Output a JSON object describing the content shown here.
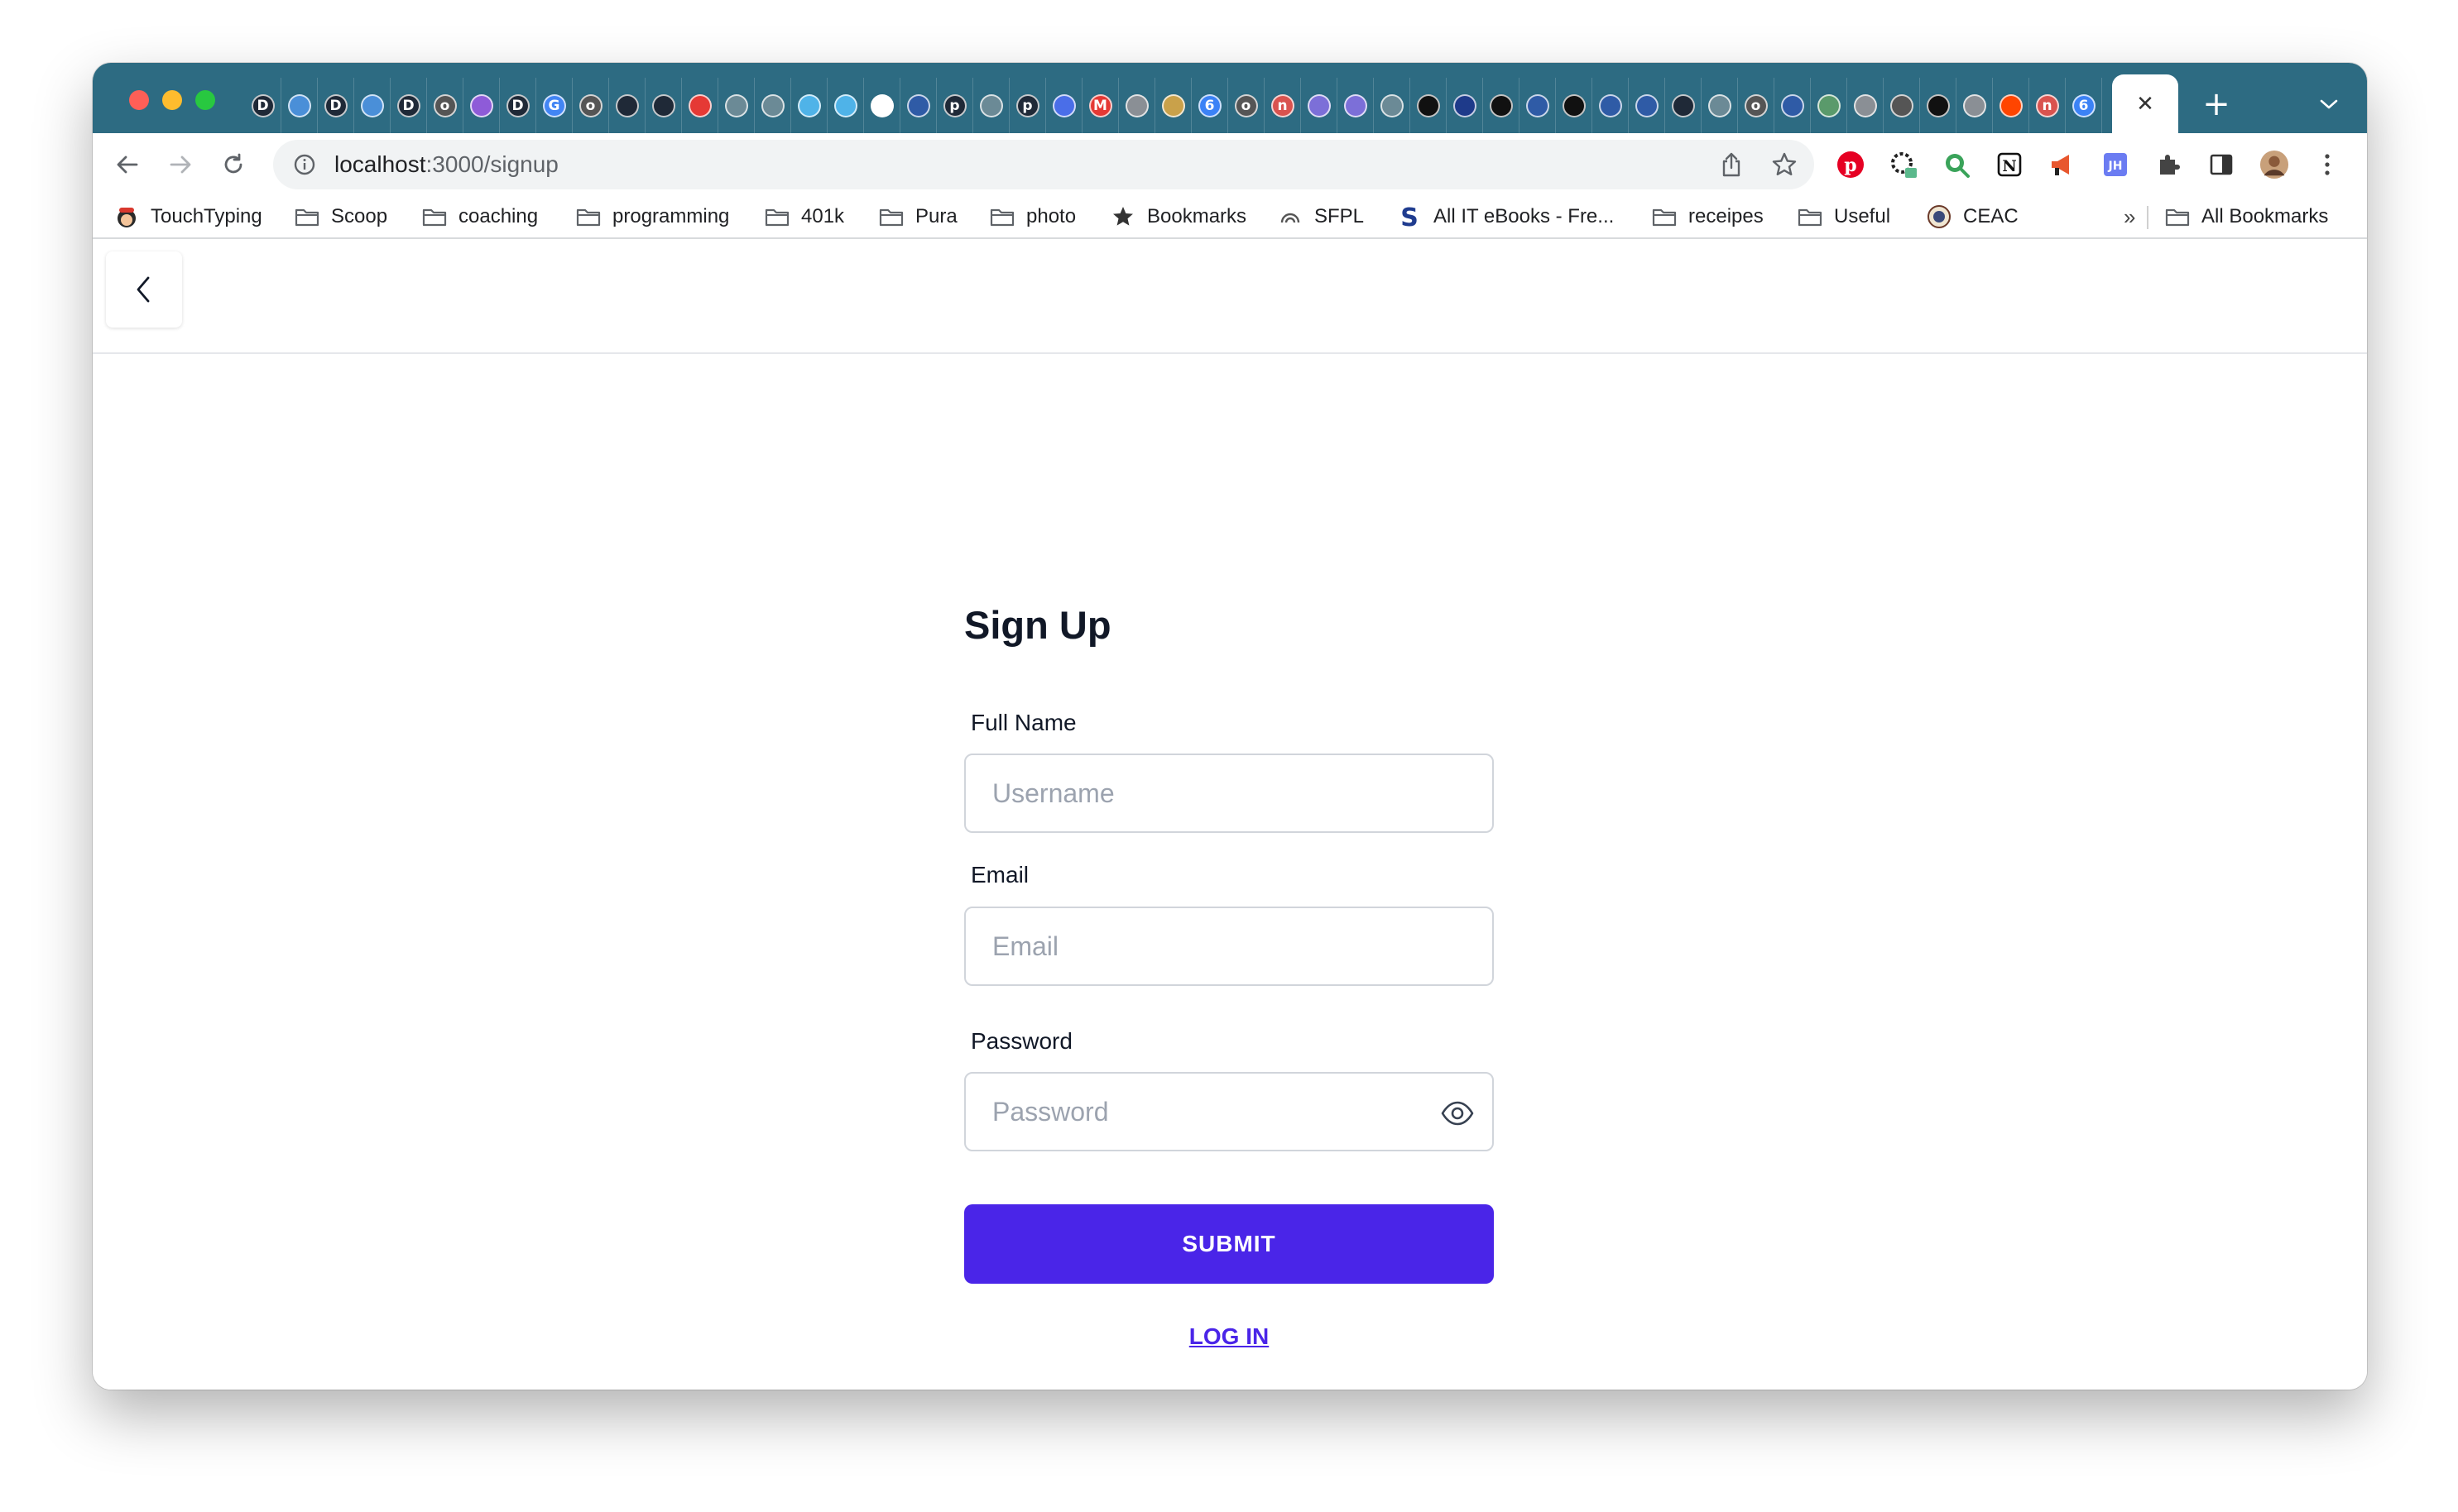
{
  "browser": {
    "url_host": "localhost",
    "url_path": ":3000/signup",
    "pinned_tab_icons": [
      {
        "name": "dev-icon",
        "glyph": "D",
        "color": "#1f2937"
      },
      {
        "name": "circle-icon",
        "glyph": "",
        "color": "#4a8fd8"
      },
      {
        "name": "dev-icon",
        "glyph": "D",
        "color": "#1f2937"
      },
      {
        "name": "circle-icon",
        "glyph": "",
        "color": "#4a8fd8"
      },
      {
        "name": "dev-icon",
        "glyph": "D",
        "color": "#1f2937"
      },
      {
        "name": "outline-icon",
        "glyph": "o",
        "color": "#555555"
      },
      {
        "name": "shield-icon",
        "glyph": "",
        "color": "#8e5bd8"
      },
      {
        "name": "dev-icon",
        "glyph": "D",
        "color": "#1f2937"
      },
      {
        "name": "google-icon",
        "glyph": "G",
        "color": "#4285f4"
      },
      {
        "name": "outline-icon",
        "glyph": "o",
        "color": "#555555"
      },
      {
        "name": "shield-icon",
        "glyph": "",
        "color": "#1f2937"
      },
      {
        "name": "shield-icon",
        "glyph": "",
        "color": "#1f2937"
      },
      {
        "name": "youtube-icon",
        "glyph": "",
        "color": "#e53935"
      },
      {
        "name": "circle-icon",
        "glyph": "",
        "color": "#6b8a96"
      },
      {
        "name": "circle-icon",
        "glyph": "",
        "color": "#6b8a96"
      },
      {
        "name": "react-icon",
        "glyph": "",
        "color": "#4fb3e8"
      },
      {
        "name": "circle-icon",
        "glyph": "",
        "color": "#4fb3e8"
      },
      {
        "name": "sail-icon",
        "glyph": "",
        "color": "#ffffff"
      },
      {
        "name": "circle-icon",
        "glyph": "",
        "color": "#2f5ba6"
      },
      {
        "name": "p-icon",
        "glyph": "p",
        "color": "#1f2937"
      },
      {
        "name": "circle-icon",
        "glyph": "",
        "color": "#6b8a96"
      },
      {
        "name": "p-icon",
        "glyph": "p",
        "color": "#1f2937"
      },
      {
        "name": "circle-icon",
        "glyph": "",
        "color": "#4a6ee8"
      },
      {
        "name": "gmail-icon",
        "glyph": "M",
        "color": "#e53935"
      },
      {
        "name": "circle-icon",
        "glyph": "",
        "color": "#8a8f95"
      },
      {
        "name": "circle-icon",
        "glyph": "",
        "color": "#c9a14a"
      },
      {
        "name": "calendar-icon",
        "glyph": "6",
        "color": "#3b82f6"
      },
      {
        "name": "outline-icon",
        "glyph": "o",
        "color": "#555555"
      },
      {
        "name": "n-icon",
        "glyph": "n",
        "color": "#d9534f"
      },
      {
        "name": "circle-icon",
        "glyph": "",
        "color": "#7c6fd8"
      },
      {
        "name": "circle-icon",
        "glyph": "",
        "color": "#7c6fd8"
      },
      {
        "name": "circle-icon",
        "glyph": "",
        "color": "#6b8a96"
      },
      {
        "name": "gear-icon",
        "glyph": "",
        "color": "#111111"
      },
      {
        "name": "circle-icon",
        "glyph": "",
        "color": "#1e3a8a"
      },
      {
        "name": "gear-icon",
        "glyph": "",
        "color": "#111111"
      },
      {
        "name": "circle-icon",
        "glyph": "",
        "color": "#2f5ba6"
      },
      {
        "name": "gear-icon",
        "glyph": "",
        "color": "#111111"
      },
      {
        "name": "circle-icon",
        "glyph": "",
        "color": "#2f5ba6"
      },
      {
        "name": "circle-icon",
        "glyph": "",
        "color": "#2f5ba6"
      },
      {
        "name": "check-icon",
        "glyph": "",
        "color": "#1f2937"
      },
      {
        "name": "circle-icon",
        "glyph": "",
        "color": "#6b8a96"
      },
      {
        "name": "outline-icon",
        "glyph": "o",
        "color": "#555555"
      },
      {
        "name": "circle-icon",
        "glyph": "",
        "color": "#2f5ba6"
      },
      {
        "name": "circle-icon",
        "glyph": "",
        "color": "#5a9a6b"
      },
      {
        "name": "circle-icon",
        "glyph": "",
        "color": "#8a8f95"
      },
      {
        "name": "github-icon",
        "glyph": "",
        "color": "#555555"
      },
      {
        "name": "github-icon",
        "glyph": "",
        "color": "#111111"
      },
      {
        "name": "circle-icon",
        "glyph": "",
        "color": "#8a8f95"
      },
      {
        "name": "reddit-icon",
        "glyph": "",
        "color": "#ff4500"
      },
      {
        "name": "n-icon",
        "glyph": "n",
        "color": "#d9534f"
      },
      {
        "name": "calendar-icon",
        "glyph": "6",
        "color": "#3b82f6"
      }
    ],
    "active_tab_close": "✕",
    "new_tab": "+"
  },
  "bookmarks": [
    {
      "label": "TouchTyping",
      "icon": "touchtyping-icon"
    },
    {
      "label": "Scoop",
      "icon": "folder-icon"
    },
    {
      "label": "coaching",
      "icon": "folder-icon"
    },
    {
      "label": "programming",
      "icon": "folder-icon"
    },
    {
      "label": "401k",
      "icon": "folder-icon"
    },
    {
      "label": "Pura",
      "icon": "folder-icon"
    },
    {
      "label": "photo",
      "icon": "folder-icon"
    },
    {
      "label": "Bookmarks",
      "icon": "star-icon"
    },
    {
      "label": "SFPL",
      "icon": "sfpl-icon"
    },
    {
      "label": "All IT eBooks - Fre...",
      "icon": "s-logo-icon"
    },
    {
      "label": "receipes",
      "icon": "folder-icon"
    },
    {
      "label": "Useful",
      "icon": "folder-icon"
    },
    {
      "label": "CEAC",
      "icon": "seal-icon"
    }
  ],
  "bookmarks_overflow": "»",
  "all_bookmarks": "All Bookmarks",
  "form": {
    "title": "Sign Up",
    "full_name_label": "Full Name",
    "full_name_placeholder": "Username",
    "email_label": "Email",
    "email_placeholder": "Email",
    "password_label": "Password",
    "password_placeholder": "Password",
    "submit_label": "SUBMIT",
    "login_label": "LOG IN"
  },
  "colors": {
    "tabstrip": "#2d6b82",
    "accent": "#4a25e8"
  }
}
